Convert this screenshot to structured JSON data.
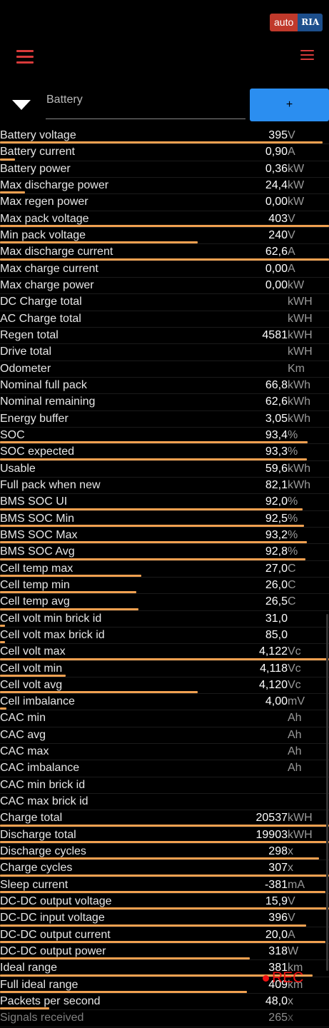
{
  "watermark": {
    "part1": "auto",
    "part2": "RIA"
  },
  "header": {
    "tab_label": "Battery",
    "add_label": "+"
  },
  "rec_label": "REC",
  "rows": [
    {
      "name": "Battery voltage",
      "value": "395",
      "unit": "V",
      "bar": 0.98
    },
    {
      "name": "Battery current",
      "value": "0,90",
      "unit": "A",
      "bar": 0.045
    },
    {
      "name": "Battery power",
      "value": "0,36",
      "unit": "kW",
      "bar": 0.0
    },
    {
      "name": "Max discharge power",
      "value": "24,4",
      "unit": "kW",
      "bar": 0.075
    },
    {
      "name": "Max regen power",
      "value": "0,00",
      "unit": "kW",
      "bar": 0.0
    },
    {
      "name": "Max pack voltage",
      "value": "403",
      "unit": "V",
      "bar": 1.0
    },
    {
      "name": "Min pack voltage",
      "value": "240",
      "unit": "V",
      "bar": 0.6
    },
    {
      "name": "Max discharge current",
      "value": "62,6",
      "unit": "A",
      "bar": 1.0
    },
    {
      "name": "Max charge current",
      "value": "0,00",
      "unit": "A",
      "bar": 0.0
    },
    {
      "name": "Max charge power",
      "value": "0,00",
      "unit": "kW",
      "bar": 0.0
    },
    {
      "name": "DC Charge total",
      "value": "",
      "unit": "kWH",
      "bar": 0.0
    },
    {
      "name": "AC Charge total",
      "value": "",
      "unit": "kWH",
      "bar": 0.0
    },
    {
      "name": "Regen total",
      "value": "4581",
      "unit": "kWH",
      "bar": 0.0
    },
    {
      "name": "Drive total",
      "value": "",
      "unit": "kWH",
      "bar": 0.0
    },
    {
      "name": "Odometer",
      "value": "",
      "unit": "Km",
      "bar": 0.0
    },
    {
      "name": "Nominal full pack",
      "value": "66,8",
      "unit": "kWh",
      "bar": 0.0
    },
    {
      "name": "Nominal remaining",
      "value": "62,6",
      "unit": "kWh",
      "bar": 0.0
    },
    {
      "name": "Energy buffer",
      "value": "3,05",
      "unit": "kWh",
      "bar": 0.0
    },
    {
      "name": "SOC",
      "value": "93,4",
      "unit": "%",
      "bar": 0.934
    },
    {
      "name": "SOC expected",
      "value": "93,3",
      "unit": "%",
      "bar": 0.933
    },
    {
      "name": "Usable",
      "value": "59,6",
      "unit": "kWh",
      "bar": 0.0
    },
    {
      "name": "Full pack when new",
      "value": "82,1",
      "unit": "kWh",
      "bar": 0.0
    },
    {
      "name": "BMS SOC UI",
      "value": "92,0",
      "unit": "%",
      "bar": 0.92
    },
    {
      "name": "BMS SOC Min",
      "value": "92,5",
      "unit": "%",
      "bar": 0.925
    },
    {
      "name": "BMS SOC Max",
      "value": "93,2",
      "unit": "%",
      "bar": 0.932
    },
    {
      "name": "BMS SOC Avg",
      "value": "92,8",
      "unit": "%",
      "bar": 0.928
    },
    {
      "name": "Cell temp max",
      "value": "27,0",
      "unit": "C",
      "bar": 0.43
    },
    {
      "name": "Cell temp min",
      "value": "26,0",
      "unit": "C",
      "bar": 0.415
    },
    {
      "name": "Cell temp avg",
      "value": "26,5",
      "unit": "C",
      "bar": 0.42
    },
    {
      "name": "Cell volt min brick id",
      "value": "31,0",
      "unit": "",
      "bar": 0.015
    },
    {
      "name": "Cell volt max brick id",
      "value": "85,0",
      "unit": "",
      "bar": 0.015
    },
    {
      "name": "Cell volt max",
      "value": "4,122",
      "unit": "Vc",
      "bar": 1.0
    },
    {
      "name": "Cell volt min",
      "value": "4,118",
      "unit": "Vc",
      "bar": 0.2
    },
    {
      "name": "Cell volt avg",
      "value": "4,120",
      "unit": "Vc",
      "bar": 0.6
    },
    {
      "name": "Cell imbalance",
      "value": "4,00",
      "unit": "mV",
      "bar": 0.02
    },
    {
      "name": "CAC min",
      "value": "",
      "unit": "Ah",
      "bar": 0.0
    },
    {
      "name": "CAC avg",
      "value": "",
      "unit": "Ah",
      "bar": 0.0
    },
    {
      "name": "CAC max",
      "value": "",
      "unit": "Ah",
      "bar": 0.0
    },
    {
      "name": "CAC imbalance",
      "value": "",
      "unit": "Ah",
      "bar": 0.0
    },
    {
      "name": "CAC min brick id",
      "value": "",
      "unit": "",
      "bar": 0.0
    },
    {
      "name": "CAC max brick id",
      "value": "",
      "unit": "",
      "bar": 0.0
    },
    {
      "name": "Charge total",
      "value": "20537",
      "unit": "kWH",
      "bar": 1.0
    },
    {
      "name": "Discharge total",
      "value": "19903",
      "unit": "kWH",
      "bar": 1.0
    },
    {
      "name": "Discharge cycles",
      "value": "298",
      "unit": "x",
      "bar": 0.97
    },
    {
      "name": "Charge cycles",
      "value": "307",
      "unit": "x",
      "bar": 1.0
    },
    {
      "name": "Sleep current",
      "value": "-381",
      "unit": "mA",
      "bar": 0.99
    },
    {
      "name": "DC-DC output voltage",
      "value": "15,9",
      "unit": "V",
      "bar": 1.0
    },
    {
      "name": "DC-DC input voltage",
      "value": "396",
      "unit": "V",
      "bar": 0.93
    },
    {
      "name": "DC-DC output current",
      "value": "20,0",
      "unit": "A",
      "bar": 0.99
    },
    {
      "name": "DC-DC output power",
      "value": "318",
      "unit": "W",
      "bar": 0.76
    },
    {
      "name": "Ideal range",
      "value": "381",
      "unit": "km",
      "bar": 0.95
    },
    {
      "name": "Full ideal range",
      "value": "409",
      "unit": "km",
      "bar": 0.75
    },
    {
      "name": "Packets per second",
      "value": "48,0",
      "unit": "x",
      "bar": 0.15
    },
    {
      "name": "Signals received",
      "value": "265",
      "unit": "x",
      "bar": 0.0
    }
  ]
}
